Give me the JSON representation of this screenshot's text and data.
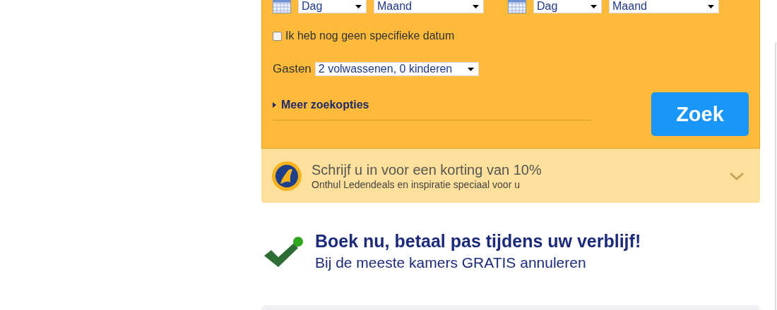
{
  "search_form": {
    "checkin": {
      "day": "Dag",
      "month": "Maand"
    },
    "checkout": {
      "day": "Dag",
      "month": "Maand"
    },
    "no_date": {
      "label": "Ik heb nog geen specifieke datum",
      "checked": false
    },
    "guests": {
      "label": "Gasten",
      "value": "2 volwassenen, 0 kinderen"
    },
    "more_options": "Meer zoekopties",
    "search_button": "Zoek"
  },
  "promo": {
    "title": "Schrijf u in voor een korting van 10%",
    "subtitle": "Onthul Ledendeals en inspiratie speciaal voor u"
  },
  "booking_note": {
    "title": "Boek nu, betaal pas tijdens uw verblijf!",
    "subtitle": "Bij de meeste kamers GRATIS annuleren"
  }
}
